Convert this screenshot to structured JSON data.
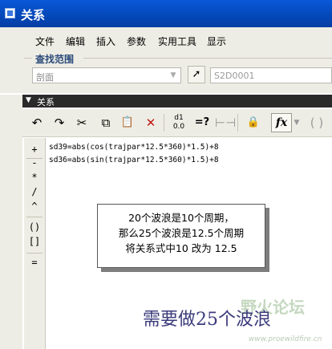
{
  "window": {
    "title": "关系"
  },
  "menu": [
    {
      "label": "文件"
    },
    {
      "label": "编辑"
    },
    {
      "label": "插入"
    },
    {
      "label": "参数"
    },
    {
      "label": "实用工具"
    },
    {
      "label": "显示"
    }
  ],
  "find_scope": {
    "label": "查找范围",
    "combo_value": "剖面",
    "selection_value": "S2D0001"
  },
  "section": {
    "label": "关系"
  },
  "toolbar": {
    "undo": "↶",
    "redo": "↷",
    "cut": "✂",
    "copy": "⧉",
    "paste": "📋",
    "delete": "✕",
    "eval": "=?",
    "fx": "fx"
  },
  "operators": [
    "+",
    "-",
    "*",
    "/",
    "^",
    "()",
    "[]",
    "="
  ],
  "relations": [
    "sd39=abs(cos(trajpar*12.5*360)*1.5)+8",
    "sd36=abs(sin(trajpar*12.5*360)*1.5)+8"
  ],
  "note": {
    "lines": [
      "20个波浪是10个周期，",
      "那么25个波浪是12.5个周期",
      "将关系式中10 改为 12.5"
    ]
  },
  "caption": "需要做25个波浪",
  "watermark": {
    "text": "野火论坛",
    "url": "www.proewildfire.cn"
  }
}
